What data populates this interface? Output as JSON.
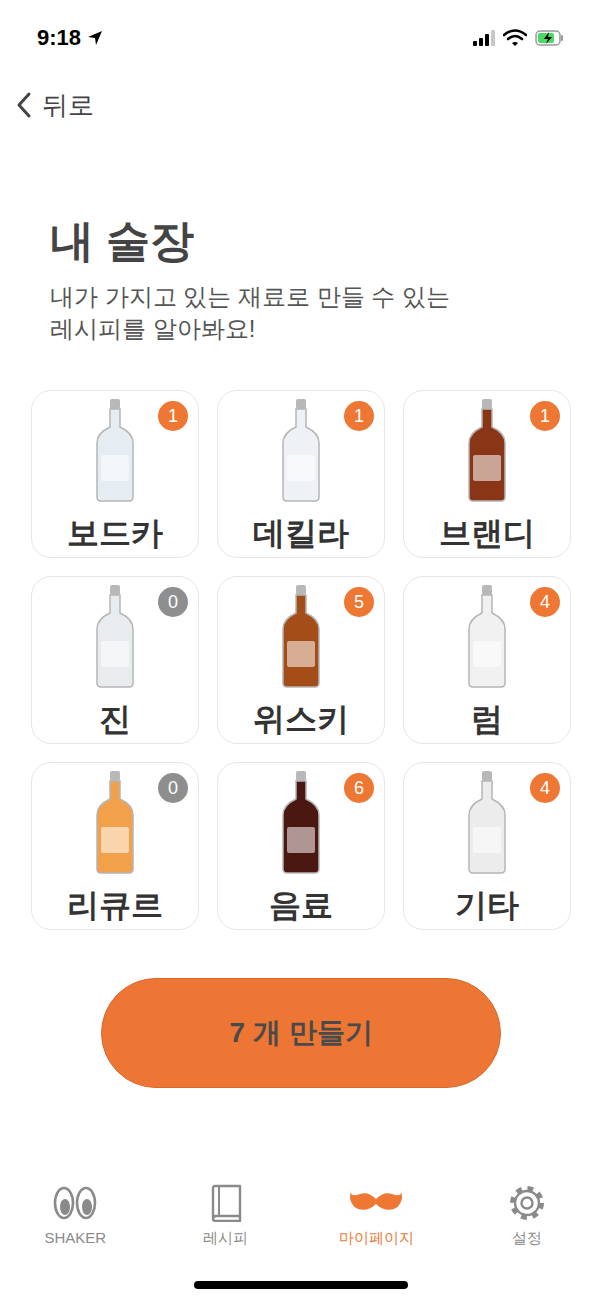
{
  "status_bar": {
    "time": "9:18"
  },
  "nav": {
    "back": "뒤로"
  },
  "page": {
    "title": "내 술장",
    "subtitle_lines": [
      "내가 가지고 있는 재료로 만들 수 있는",
      "레시피를 알아봐요!"
    ]
  },
  "categories": [
    {
      "label": "보드카",
      "count": "1",
      "has_items": true,
      "color": "#e6edf2"
    },
    {
      "label": "데킬라",
      "count": "1",
      "has_items": true,
      "color": "#eef1f5"
    },
    {
      "label": "브랜디",
      "count": "1",
      "has_items": true,
      "color": "#8a3516"
    },
    {
      "label": "진",
      "count": "0",
      "has_items": false,
      "color": "#e9ecef"
    },
    {
      "label": "위스키",
      "count": "5",
      "has_items": true,
      "color": "#a44d18"
    },
    {
      "label": "럼",
      "count": "4",
      "has_items": true,
      "color": "#f1f1f1"
    },
    {
      "label": "리큐르",
      "count": "0",
      "has_items": false,
      "color": "#f2a04a"
    },
    {
      "label": "음료",
      "count": "6",
      "has_items": true,
      "color": "#4a1810"
    },
    {
      "label": "기타",
      "count": "4",
      "has_items": true,
      "color": "#ececec"
    }
  ],
  "make_button": "7 개 만들기",
  "tab_bar": [
    {
      "label": "SHAKER",
      "selected": false,
      "kind": "eyes"
    },
    {
      "label": "레시피",
      "selected": false,
      "kind": "book"
    },
    {
      "label": "마이페이지",
      "selected": true,
      "kind": "mustache"
    },
    {
      "label": "설정",
      "selected": false,
      "kind": "gear"
    }
  ]
}
